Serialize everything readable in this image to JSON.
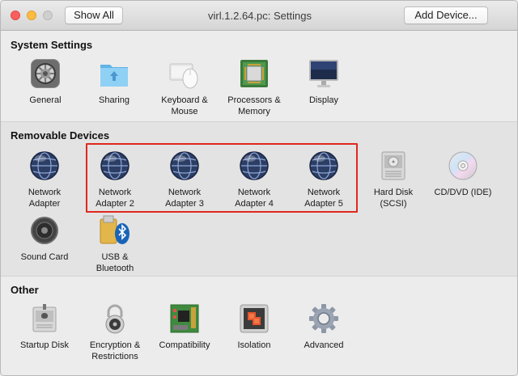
{
  "window": {
    "title": "virl.1.2.64.pc: Settings",
    "show_all_label": "Show All",
    "add_device_label": "Add Device..."
  },
  "sections": {
    "system": {
      "title": "System Settings",
      "items": [
        {
          "label": "General",
          "icon": "general-icon"
        },
        {
          "label": "Sharing",
          "icon": "sharing-folder-icon"
        },
        {
          "label": "Keyboard &\nMouse",
          "icon": "keyboard-mouse-icon"
        },
        {
          "label": "Processors &\nMemory",
          "icon": "processor-memory-icon"
        },
        {
          "label": "Display",
          "icon": "display-icon"
        }
      ]
    },
    "removable": {
      "title": "Removable Devices",
      "items": [
        {
          "label": "Network\nAdapter",
          "icon": "network-globe-icon"
        },
        {
          "label": "Network\nAdapter 2",
          "icon": "network-globe-icon"
        },
        {
          "label": "Network\nAdapter 3",
          "icon": "network-globe-icon"
        },
        {
          "label": "Network\nAdapter 4",
          "icon": "network-globe-icon"
        },
        {
          "label": "Network\nAdapter 5",
          "icon": "network-globe-icon"
        },
        {
          "label": "Hard Disk\n(SCSI)",
          "icon": "hard-disk-icon"
        },
        {
          "label": "CD/DVD (IDE)",
          "icon": "cd-dvd-icon"
        },
        {
          "label": "Sound Card",
          "icon": "speaker-icon"
        },
        {
          "label": "USB &\nBluetooth",
          "icon": "usb-bluetooth-icon"
        }
      ]
    },
    "other": {
      "title": "Other",
      "items": [
        {
          "label": "Startup Disk",
          "icon": "startup-disk-icon"
        },
        {
          "label": "Encryption &\nRestrictions",
          "icon": "padlock-icon"
        },
        {
          "label": "Compatibility",
          "icon": "motherboard-icon"
        },
        {
          "label": "Isolation",
          "icon": "isolation-icon"
        },
        {
          "label": "Advanced",
          "icon": "gear-icon"
        }
      ]
    }
  },
  "colors": {
    "highlight": "#e0281d",
    "globe": "#2c3e64"
  }
}
